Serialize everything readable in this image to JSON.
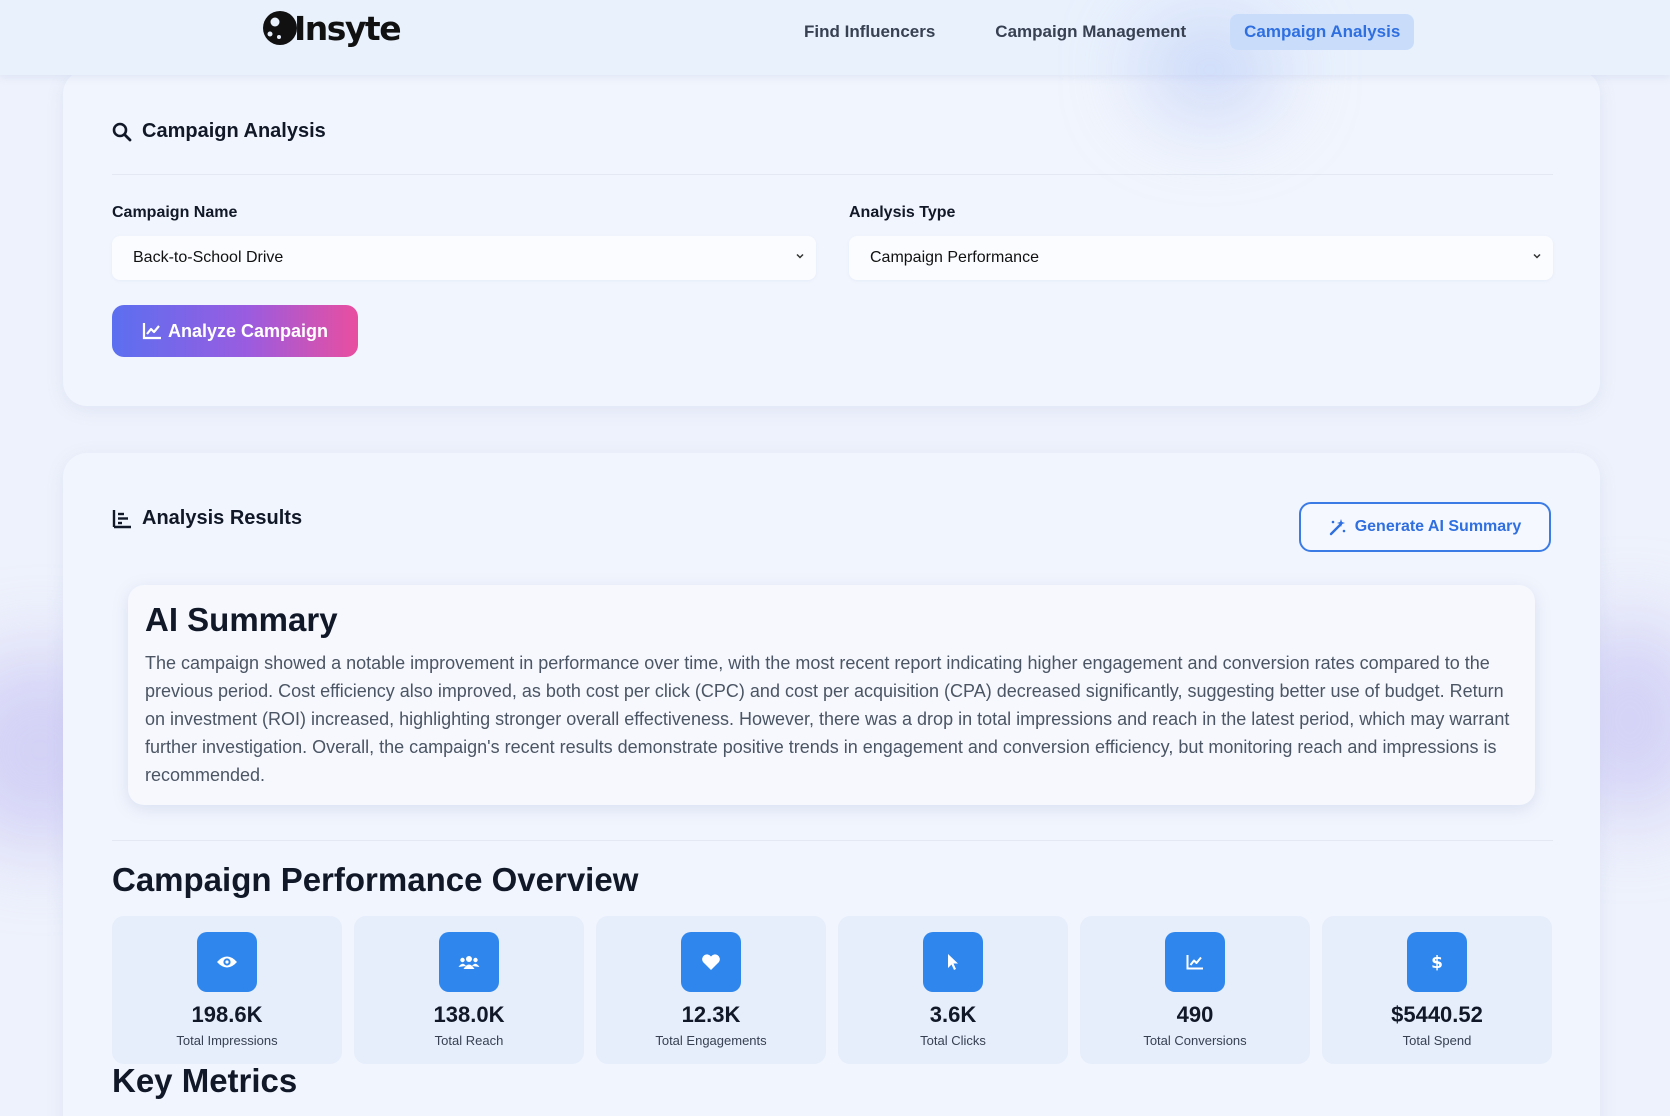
{
  "app": {
    "logo_text": "Insyte"
  },
  "nav": {
    "items": [
      {
        "label": "Find Influencers"
      },
      {
        "label": "Campaign Management"
      },
      {
        "label": "Campaign Analysis",
        "active": true
      }
    ]
  },
  "analysis_form": {
    "title": "Campaign Analysis",
    "campaign_name_label": "Campaign Name",
    "campaign_name_value": "Back-to-School Drive",
    "analysis_type_label": "Analysis Type",
    "analysis_type_value": "Campaign Performance",
    "analyze_button": "Analyze Campaign"
  },
  "results": {
    "title": "Analysis Results",
    "generate_button": "Generate AI Summary",
    "ai_summary": {
      "title": "AI Summary",
      "text": "The campaign showed a notable improvement in performance over time, with the most recent report indicating higher engagement and conversion rates compared to the previous period. Cost efficiency also improved, as both cost per click (CPC) and cost per acquisition (CPA) decreased significantly, suggesting better use of budget. Return on investment (ROI) increased, highlighting stronger overall effectiveness. However, there was a drop in total impressions and reach in the latest period, which may warrant further investigation. Overall, the campaign's recent results demonstrate positive trends in engagement and conversion efficiency, but monitoring reach and impressions is recommended."
    },
    "overview_title": "Campaign Performance Overview",
    "metrics": [
      {
        "value": "198.6K",
        "label": "Total Impressions",
        "icon": "eye-icon"
      },
      {
        "value": "138.0K",
        "label": "Total Reach",
        "icon": "users-icon"
      },
      {
        "value": "12.3K",
        "label": "Total Engagements",
        "icon": "heart-icon"
      },
      {
        "value": "3.6K",
        "label": "Total Clicks",
        "icon": "cursor-icon"
      },
      {
        "value": "490",
        "label": "Total Conversions",
        "icon": "chart-line-icon"
      },
      {
        "value": "$5440.52",
        "label": "Total Spend",
        "icon": "dollar-icon"
      }
    ],
    "key_metrics_title": "Key Metrics"
  },
  "colors": {
    "accent": "#2f6fe0",
    "metric_icon_bg": "#2f86ec",
    "gradient_start": "#5b6ff0",
    "gradient_end": "#e94e9f"
  }
}
